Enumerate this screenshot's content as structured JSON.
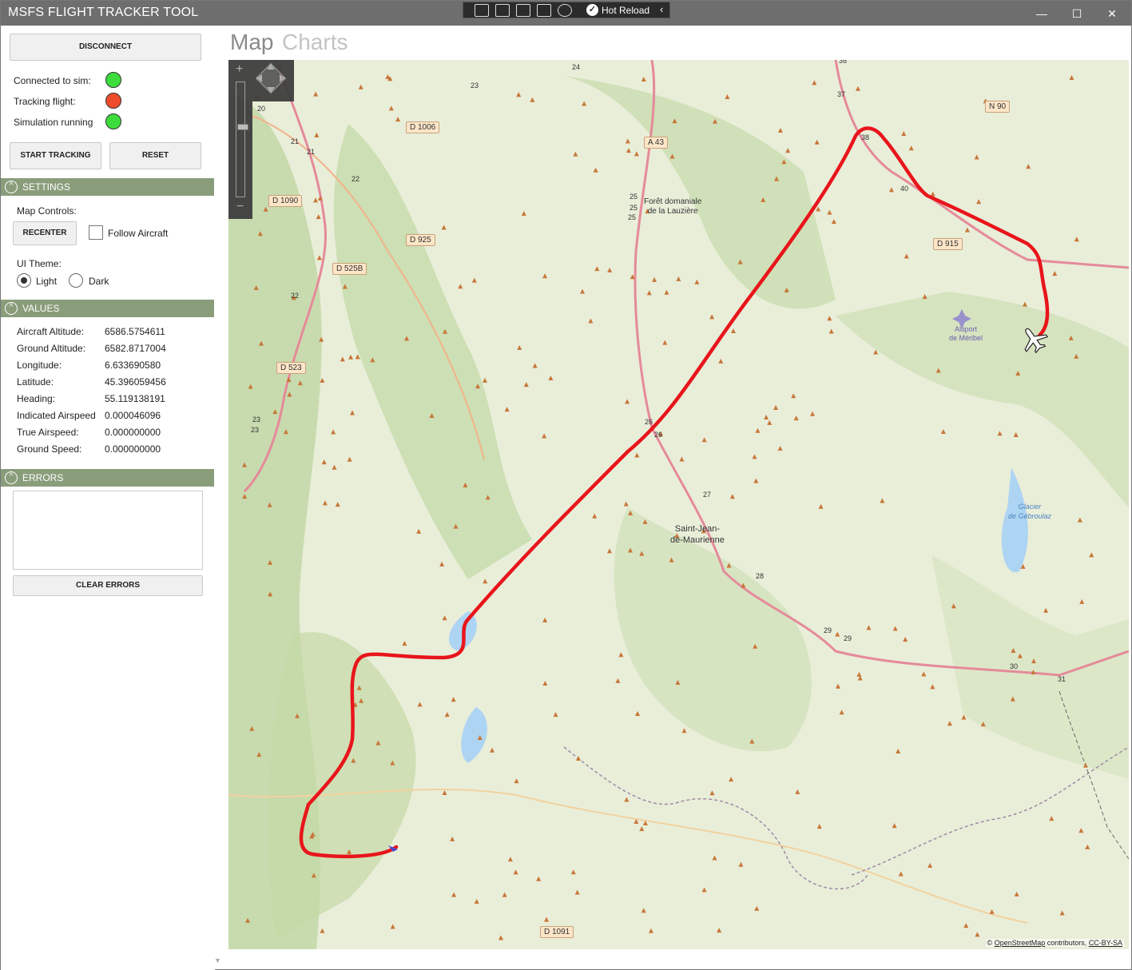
{
  "window": {
    "title": "MSFS FLIGHT TRACKER TOOL",
    "controls": {
      "minimize": "—",
      "maximize": "☐",
      "close": "✕"
    }
  },
  "devbar": {
    "hot_reload_label": "Hot Reload",
    "chevron": "‹"
  },
  "connection": {
    "disconnect_label": "DISCONNECT"
  },
  "status": {
    "connected_label": "Connected to sim:",
    "connected_color": "#3ddc3d",
    "tracking_label": "Tracking flight:",
    "tracking_color": "#ee4b2b",
    "running_label": "Simulation running",
    "running_color": "#3ddc3d"
  },
  "actions": {
    "start_tracking_label": "START TRACKING",
    "reset_label": "RESET"
  },
  "settings": {
    "header": "SETTINGS",
    "map_controls_label": "Map Controls:",
    "recenter_label": "RECENTER",
    "follow_aircraft_label": "Follow Aircraft",
    "follow_aircraft_checked": false,
    "ui_theme_label": "UI Theme:",
    "theme_light_label": "Light",
    "theme_dark_label": "Dark",
    "selected_theme": "Light"
  },
  "values": {
    "header": "VALUES",
    "rows": [
      {
        "label": "Aircraft Altitude:",
        "value": "6586.5754611"
      },
      {
        "label": "Ground Altitude:",
        "value": "6582.8717004"
      },
      {
        "label": "Longitude:",
        "value": "6.633690580"
      },
      {
        "label": "Latitude:",
        "value": "45.396059456"
      },
      {
        "label": "Heading:",
        "value": "55.119138191"
      },
      {
        "label": "Indicated Airspeed",
        "value": "0.000046096"
      },
      {
        "label": "True Airspeed:",
        "value": "0.000000000"
      },
      {
        "label": "Ground Speed:",
        "value": "0.000000000"
      }
    ]
  },
  "errors": {
    "header": "ERRORS",
    "content": "",
    "clear_label": "CLEAR ERRORS"
  },
  "tabs": [
    {
      "label": "Map",
      "active": true,
      "color": "#8a8a8a"
    },
    {
      "label": "Charts",
      "active": false,
      "color": "#c3c3c3"
    }
  ],
  "map": {
    "zoom_plus": "+",
    "zoom_minus": "−",
    "road_labels": [
      "D 1006",
      "A 43",
      "N 90",
      "D 1090",
      "D 925",
      "D 525B",
      "D 523",
      "D 915",
      "D 1091"
    ],
    "place_labels": [
      "Forêt domaniale",
      "de la Lauzière",
      "Saint-Jean-",
      "de-Maurienne"
    ],
    "water_labels": [
      "Glacier",
      "de Gébroulaz"
    ],
    "airport_labels": [
      "Altiport",
      "de Méribel"
    ],
    "road_numbers": [
      "24",
      "23",
      "20",
      "21",
      "21",
      "22",
      "36",
      "37",
      "38",
      "40",
      "25",
      "25",
      "25",
      "22",
      "23",
      "23",
      "26",
      "26",
      "27",
      "28",
      "29",
      "29",
      "30",
      "31"
    ],
    "attribution_prefix": "©",
    "attribution_link": "OpenStreetMap",
    "attribution_mid": "contributors,",
    "attribution_license": "CC-BY-SA",
    "track_color": "#e8151b",
    "aircraft_icon": "airplane-icon"
  }
}
